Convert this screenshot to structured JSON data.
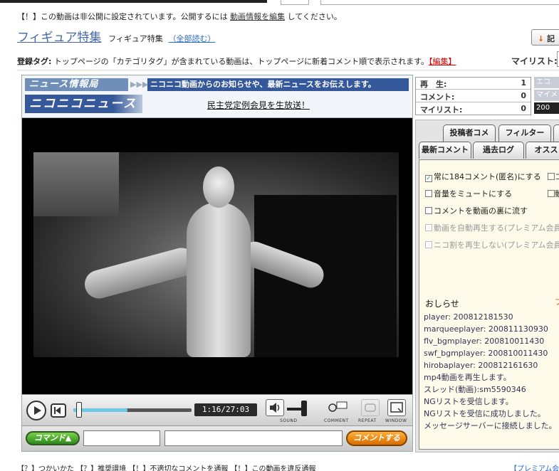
{
  "header": {
    "private_notice_prefix": "【！】この動画は非公開に設定されています。公開するには",
    "private_notice_link": "動画情報を編集",
    "private_notice_suffix": "してください。",
    "title": "フィギュア特集",
    "subtitle": "フィギュア特集",
    "read_all": "（全部読む）",
    "mylist_button": "記",
    "tags_label": "登録タグ:",
    "tags_text": "トップページの「カテゴリタグ」が含まれている動画は、トップページに新着コメント順で表示されます。",
    "tags_edit": "【編集】",
    "mylist_label": "マイリスト:"
  },
  "news": {
    "logo_top": "ニュース情報局",
    "arrows": "▶▶▶",
    "headline": "ニコニコ動画からのお知らせや、最新ニュースをお伝えします。",
    "logo_bottom": "ニコニコニュース",
    "live_link": "民主党定例会見を生放送！"
  },
  "controls": {
    "time": "1:16/27:03",
    "progress": 0.46,
    "sound_label": "SOUND",
    "comment_label": "COMMENT",
    "repeat_label": "REPEAT",
    "window_label": "WINDOW"
  },
  "comment_bar": {
    "command_button": "コマンド▲",
    "send_button": "コメントする"
  },
  "stats": {
    "plays_label": "再　生:",
    "plays_value": "1",
    "comments_label": "コメント:",
    "comments_value": "0",
    "mylists_label": "マイリスト:",
    "mylists_value": "0",
    "side1": "エコ",
    "side2": "マイメ",
    "side3": "200"
  },
  "panel": {
    "tabs_top": [
      "投稿者コメ",
      "フィルター"
    ],
    "tabs_bottom": [
      "最新コメント",
      "過去ログ",
      "オスス"
    ],
    "options": [
      {
        "label": "常に184コメント(匿名)にする",
        "checked": true
      },
      {
        "label": "音量をミュートにする",
        "checked": false
      },
      {
        "label": "コメントを動画の裏に流す",
        "checked": false
      },
      {
        "label": "動画を自動再生する(プレミアム会員",
        "checked": false
      },
      {
        "label": "ニコ割を再生しない(プレミアム会員",
        "checked": false
      }
    ],
    "opt_right1": "コ",
    "opt_right2": "動",
    "notice_title": "おしらせ",
    "notice_link": "プ",
    "log": [
      "player: 200812181530",
      "marqueeplayer: 200811130930",
      "flv_bgmplayer: 200810011430",
      "swf_bgmplayer: 200810011430",
      "hirobaplayer: 200812161630",
      "mp4動画を再生します。",
      "スレッド(動画):sm5590346",
      "NGリストを受信します。",
      "NGリストを受信に成功しました。",
      "メッセージサーバーに接続しました。"
    ]
  },
  "footer": {
    "links": "【？】つかいかた 【？】推奨環境 【！】不適切なコメントを通報 【！】この動画を違反通報",
    "right": "【プレミアム会"
  }
}
